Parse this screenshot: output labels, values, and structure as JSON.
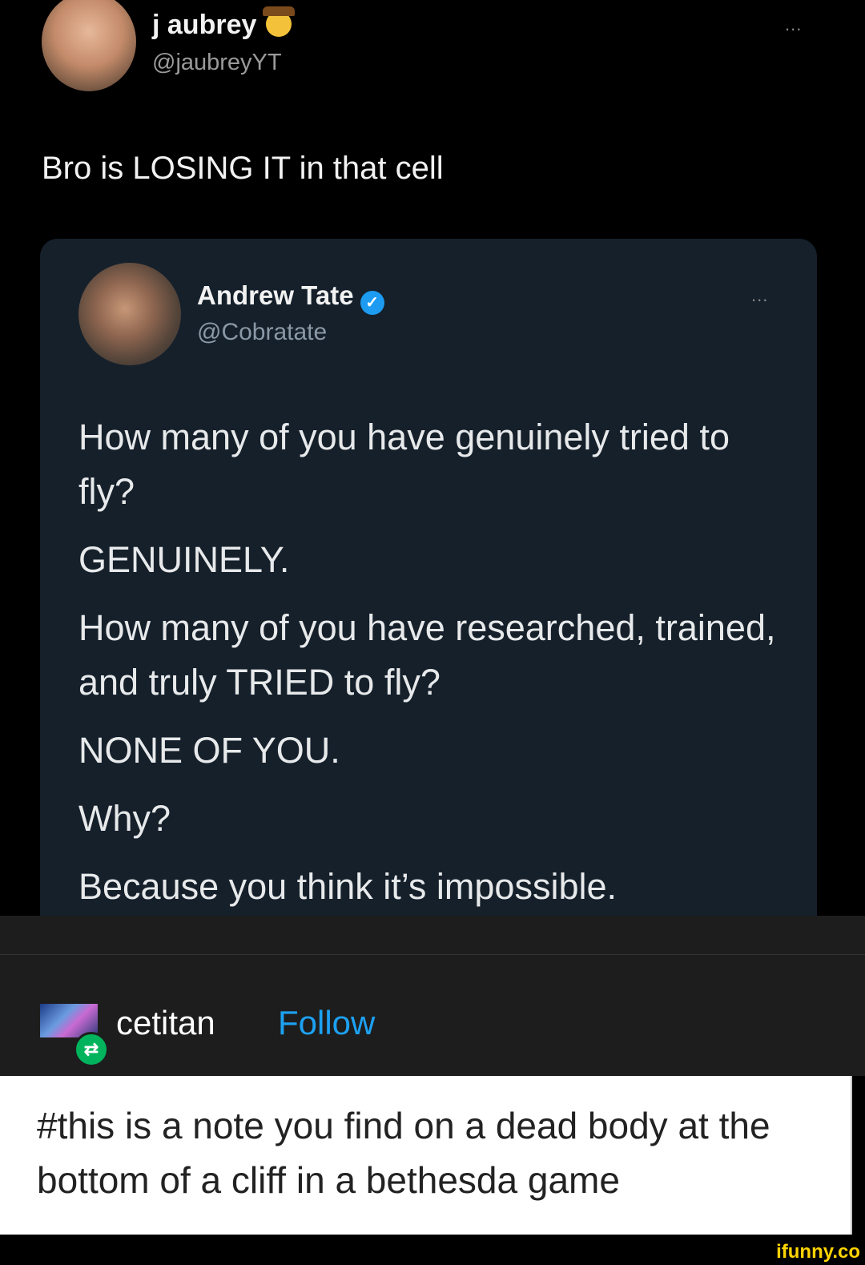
{
  "outer_tweet": {
    "display_name": "j aubrey",
    "handle": "@jaubreyYT",
    "more_label": "...",
    "text": "Bro is LOSING IT in that cell"
  },
  "quoted_tweet": {
    "display_name": "Andrew Tate",
    "verified_mark": "✓",
    "handle": "@Cobratate",
    "more_label": "...",
    "body_lines": [
      "How many of you have genuinely tried to fly?",
      "GENUINELY.",
      "How many of you have researched, trained, and truly TRIED to fly?",
      "NONE OF YOU.",
      "Why?",
      "Because you think it’s impossible."
    ]
  },
  "tumblr": {
    "username": "cetitan",
    "follow_label": "Follow",
    "reblog_icon": "⇄",
    "tags": "#this is a note you find on a dead body at the bottom of a cliff in a bethesda game"
  },
  "watermark": "ifunny.co",
  "colors": {
    "verified": "#1d9bf0",
    "follow": "#1da1f2",
    "reblog": "#00b35c",
    "card": "#15202b"
  }
}
